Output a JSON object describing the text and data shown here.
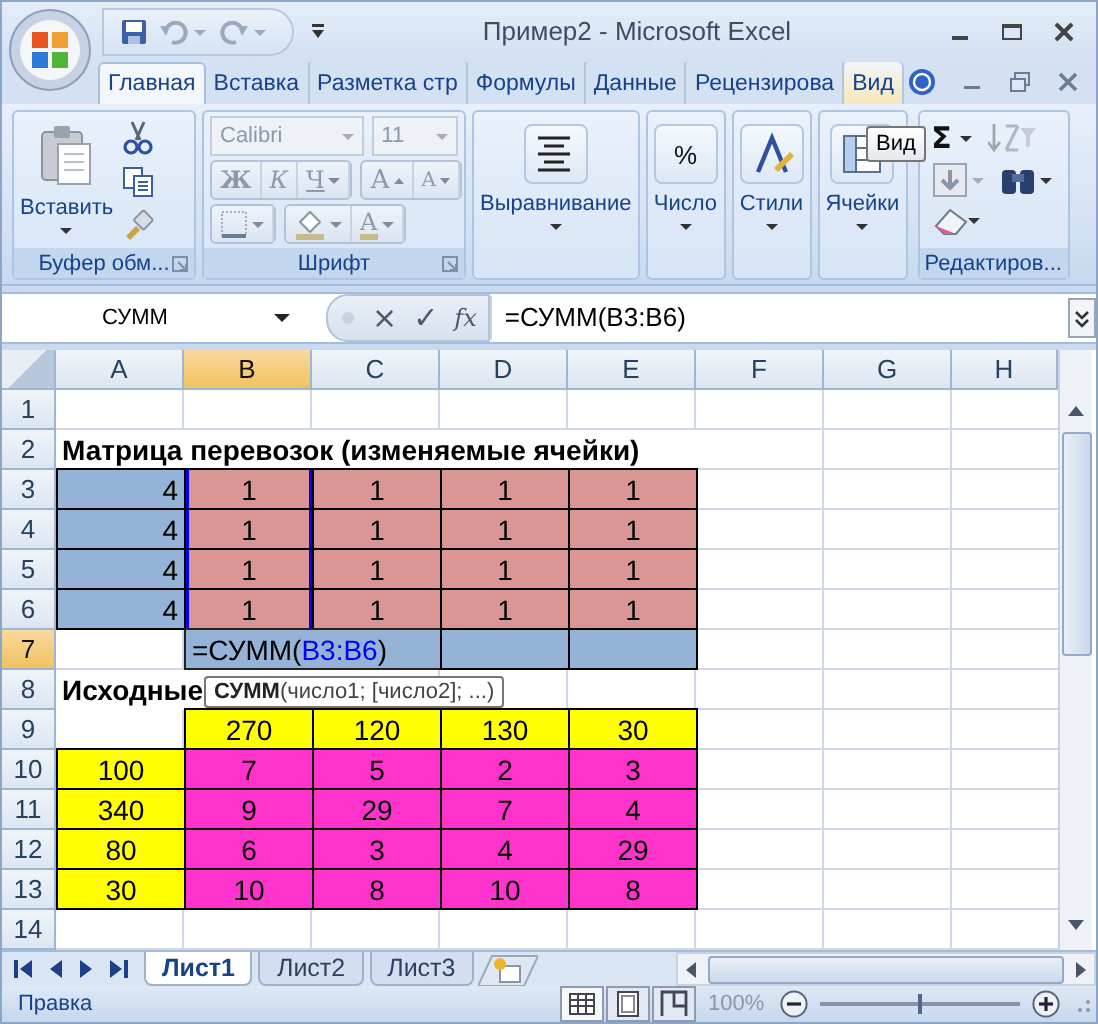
{
  "window": {
    "title": "Пример2 - Microsoft Excel"
  },
  "tabs": [
    {
      "label": "Главная",
      "selected": true,
      "hover": false
    },
    {
      "label": "Вставка",
      "selected": false,
      "hover": false
    },
    {
      "label": "Разметка стр",
      "selected": false,
      "hover": false
    },
    {
      "label": "Формулы",
      "selected": false,
      "hover": false
    },
    {
      "label": "Данные",
      "selected": false,
      "hover": false
    },
    {
      "label": "Рецензирова",
      "selected": false,
      "hover": false
    },
    {
      "label": "Вид",
      "selected": false,
      "hover": true
    }
  ],
  "ribbon": {
    "clipboard": {
      "label": "Буфер обм...",
      "paste": "Вставить"
    },
    "font": {
      "label": "Шрифт",
      "disabled": true,
      "font_name": "Calibri",
      "font_size": "11",
      "bold": "Ж",
      "italic": "К",
      "underline": "Ч",
      "grow": "A",
      "shrink": "A",
      "font_color": "A"
    },
    "collapsed": [
      {
        "label": "Выравнивание"
      },
      {
        "label": "Число",
        "glyph": "%"
      },
      {
        "label": "Стили"
      },
      {
        "label": "Ячейки"
      }
    ],
    "editing": {
      "label": "Редактиров...",
      "sum": "Σ"
    },
    "tooltip": "Вид"
  },
  "formula_bar": {
    "name_box": "СУММ",
    "cancel": "×",
    "enter": "✓",
    "function": "fx",
    "formula": "=СУММ(B3:B6)"
  },
  "sheet": {
    "columns": [
      {
        "label": "A",
        "selected": false
      },
      {
        "label": "B",
        "selected": true
      },
      {
        "label": "C",
        "selected": false
      },
      {
        "label": "D",
        "selected": false
      },
      {
        "label": "E",
        "selected": false
      },
      {
        "label": "F",
        "selected": false
      },
      {
        "label": "G",
        "selected": false
      },
      {
        "label": "H",
        "selected": false
      }
    ],
    "rows": [
      {
        "label": "1",
        "selected": false,
        "cells": [
          {},
          {},
          {},
          {},
          {},
          {},
          {},
          {}
        ]
      },
      {
        "label": "2",
        "selected": false,
        "cells": [
          {
            "text": "Матрица перевозок (изменяемые ячейки)",
            "kind": "heading"
          },
          {},
          {},
          {},
          {},
          {},
          {},
          {}
        ]
      },
      {
        "label": "3",
        "selected": false,
        "cells": [
          {
            "text": "4",
            "color": "#95b3d7",
            "kind": "number"
          },
          {
            "text": "1",
            "color": "#da9694",
            "referenced": true
          },
          {
            "text": "1",
            "color": "#da9694"
          },
          {
            "text": "1",
            "color": "#da9694"
          },
          {
            "text": "1",
            "color": "#da9694"
          },
          {},
          {},
          {}
        ]
      },
      {
        "label": "4",
        "selected": false,
        "cells": [
          {
            "text": "4",
            "color": "#95b3d7",
            "kind": "number"
          },
          {
            "text": "1",
            "color": "#da9694",
            "referenced": true
          },
          {
            "text": "1",
            "color": "#da9694"
          },
          {
            "text": "1",
            "color": "#da9694"
          },
          {
            "text": "1",
            "color": "#da9694"
          },
          {},
          {},
          {}
        ]
      },
      {
        "label": "5",
        "selected": false,
        "cells": [
          {
            "text": "4",
            "color": "#95b3d7",
            "kind": "number"
          },
          {
            "text": "1",
            "color": "#da9694",
            "referenced": true
          },
          {
            "text": "1",
            "color": "#da9694"
          },
          {
            "text": "1",
            "color": "#da9694"
          },
          {
            "text": "1",
            "color": "#da9694"
          },
          {},
          {},
          {}
        ]
      },
      {
        "label": "6",
        "selected": false,
        "cells": [
          {
            "text": "4",
            "color": "#95b3d7",
            "kind": "number"
          },
          {
            "text": "1",
            "color": "#da9694",
            "referenced": true
          },
          {
            "text": "1",
            "color": "#da9694"
          },
          {
            "text": "1",
            "color": "#da9694"
          },
          {
            "text": "1",
            "color": "#da9694"
          },
          {},
          {},
          {}
        ]
      },
      {
        "label": "7",
        "selected": true,
        "cells": [
          {},
          {
            "kind": "editing",
            "color": "#95b3d7",
            "parts": [
              {
                "text": "=СУММ("
              },
              {
                "text": "B3:B6",
                "kind": "reference"
              },
              {
                "text": ")"
              }
            ]
          },
          {
            "color": "#95b3d7"
          },
          {
            "color": "#95b3d7"
          },
          {
            "color": "#95b3d7"
          },
          {},
          {},
          {}
        ]
      },
      {
        "label": "8",
        "selected": false,
        "cells": [
          {
            "text": "Исходные",
            "kind": "heading"
          },
          {},
          {},
          {},
          {},
          {},
          {},
          {}
        ]
      },
      {
        "label": "9",
        "selected": false,
        "cells": [
          {},
          {
            "text": "270",
            "color": "#ffff00"
          },
          {
            "text": "120",
            "color": "#ffff00"
          },
          {
            "text": "130",
            "color": "#ffff00"
          },
          {
            "text": "30",
            "color": "#ffff00"
          },
          {},
          {},
          {}
        ]
      },
      {
        "label": "10",
        "selected": false,
        "cells": [
          {
            "text": "100",
            "color": "#ffff00"
          },
          {
            "text": "7",
            "color": "#ff33cc"
          },
          {
            "text": "5",
            "color": "#ff33cc"
          },
          {
            "text": "2",
            "color": "#ff33cc"
          },
          {
            "text": "3",
            "color": "#ff33cc"
          },
          {},
          {},
          {}
        ]
      },
      {
        "label": "11",
        "selected": false,
        "cells": [
          {
            "text": "340",
            "color": "#ffff00"
          },
          {
            "text": "9",
            "color": "#ff33cc"
          },
          {
            "text": "29",
            "color": "#ff33cc"
          },
          {
            "text": "7",
            "color": "#ff33cc"
          },
          {
            "text": "4",
            "color": "#ff33cc"
          },
          {},
          {},
          {}
        ]
      },
      {
        "label": "12",
        "selected": false,
        "cells": [
          {
            "text": "80",
            "color": "#ffff00"
          },
          {
            "text": "6",
            "color": "#ff33cc"
          },
          {
            "text": "3",
            "color": "#ff33cc"
          },
          {
            "text": "4",
            "color": "#ff33cc"
          },
          {
            "text": "29",
            "color": "#ff33cc"
          },
          {},
          {},
          {}
        ]
      },
      {
        "label": "13",
        "selected": false,
        "cells": [
          {
            "text": "30",
            "color": "#ffff00"
          },
          {
            "text": "10",
            "color": "#ff33cc"
          },
          {
            "text": "8",
            "color": "#ff33cc"
          },
          {
            "text": "10",
            "color": "#ff33cc"
          },
          {
            "text": "8",
            "color": "#ff33cc"
          },
          {},
          {},
          {}
        ]
      },
      {
        "label": "14",
        "selected": false,
        "cells": [
          {},
          {},
          {},
          {},
          {},
          {},
          {},
          {}
        ]
      }
    ],
    "function_tooltip": "**СУММ**(число1; [число2]; ...)"
  },
  "sheet_tabs": [
    {
      "label": "Лист1",
      "selected": true
    },
    {
      "label": "Лист2",
      "selected": false
    },
    {
      "label": "Лист3",
      "selected": false
    }
  ],
  "status_bar": {
    "mode": "Правка",
    "zoom": "100%",
    "zoom_slider": {
      "level": 0.5
    }
  }
}
